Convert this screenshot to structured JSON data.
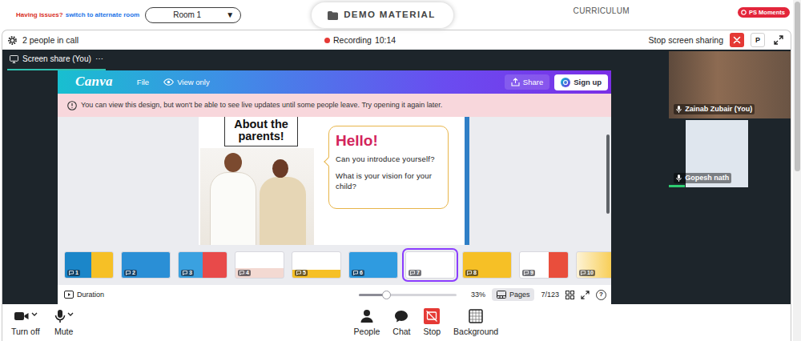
{
  "top_bar": {
    "issue_text": "Having issues?",
    "switch_link": "switch to alternate room",
    "room": {
      "label": "Room 1",
      "arrow": "▼"
    },
    "tabs": [
      {
        "label": "DEMO MATERIAL",
        "selected": true
      },
      {
        "label": "CURRICULUM",
        "selected": false
      }
    ],
    "moments_badge": "PS Moments"
  },
  "call_header": {
    "people_count": "2 people in call",
    "recording": {
      "label": "Recording",
      "time": "10:14",
      "on": true
    },
    "stop_sharing": "Stop screen sharing",
    "profile_button": "P"
  },
  "share_tab": {
    "label": "Screen share (You)",
    "menu": "⋯",
    "selected": true
  },
  "canva": {
    "logo": "Canva",
    "file_menu": "File",
    "view_only": "View only",
    "share": "Share",
    "sign_up": "Sign up",
    "warning": "You can view this design, but won't be able to see live updates until some people leave. Try opening it again later.",
    "slide": {
      "title_lines": [
        "About the",
        "parents!"
      ],
      "heading": "Hello!",
      "questions": [
        "Can you introduce yourself?",
        "What is your vision for your child?"
      ]
    },
    "canvas_scrollbar": {
      "level": 0.72
    },
    "thumbnails": [
      {
        "number": "1",
        "selected": false
      },
      {
        "number": "2",
        "selected": false
      },
      {
        "number": "3",
        "selected": false
      },
      {
        "number": "4",
        "selected": false
      },
      {
        "number": "5",
        "selected": false
      },
      {
        "number": "6",
        "selected": false
      },
      {
        "number": "7",
        "selected": true
      },
      {
        "number": "8",
        "selected": false
      },
      {
        "number": "9",
        "selected": false
      },
      {
        "number": "10",
        "selected": false
      }
    ],
    "duration": "Duration",
    "zoom": {
      "level": 0.28,
      "reading": "33%"
    },
    "pages": {
      "label": "Pages",
      "selected": true
    },
    "page_count": "7/123",
    "help": "?"
  },
  "participants": [
    {
      "name": "Zainab Zubair (You)",
      "speaking": false
    },
    {
      "name": "Gopesh nath",
      "speaking": true
    }
  ],
  "toolbar": {
    "left": [
      {
        "label": "Turn off",
        "kind": "camera",
        "dropdown": true
      },
      {
        "label": "Mute",
        "kind": "mic",
        "dropdown": true
      }
    ],
    "center": [
      {
        "label": "People",
        "kind": "people"
      },
      {
        "label": "Chat",
        "kind": "chat"
      },
      {
        "label": "Stop",
        "kind": "stop"
      },
      {
        "label": "Background",
        "kind": "background"
      }
    ]
  },
  "page_scrollbar": {
    "level": 0.5
  }
}
